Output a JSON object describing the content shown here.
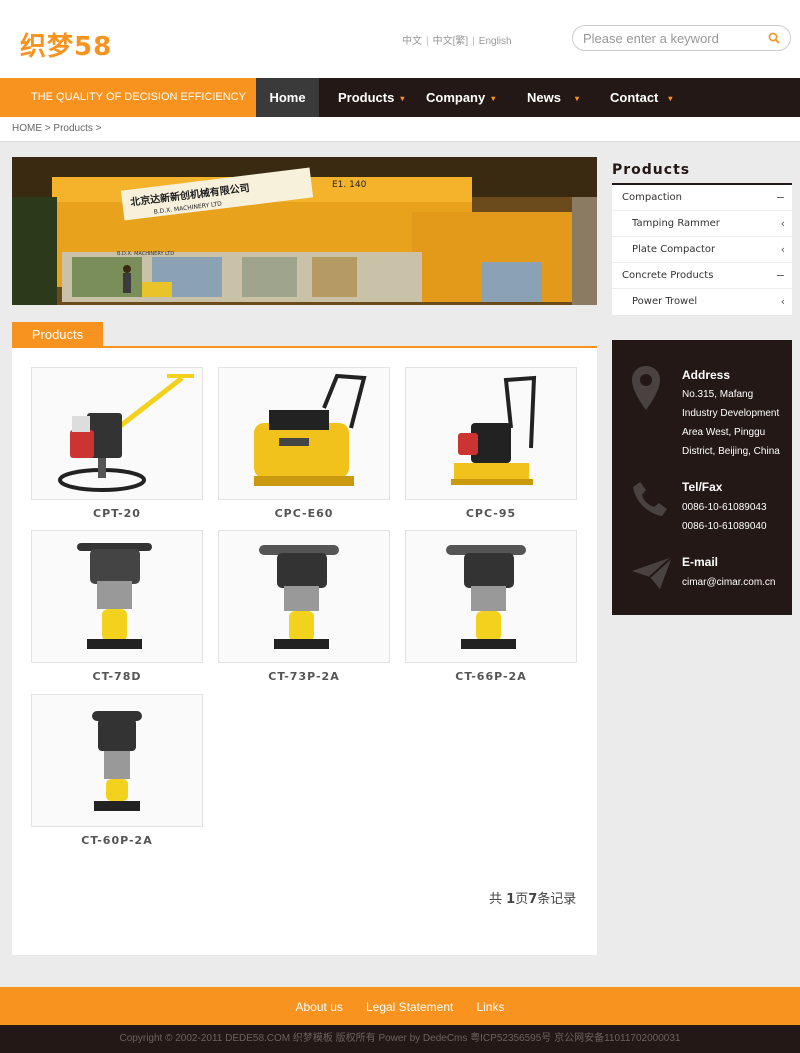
{
  "header": {
    "logo_text": "织梦58",
    "languages": [
      "中文",
      "中文[繁]",
      "English"
    ],
    "search_placeholder": "Please enter a keyword"
  },
  "nav": {
    "slogan": "THE QUALITY OF DECISION EFFICIENCY",
    "items": [
      {
        "label": "Home",
        "active": true
      },
      {
        "label": "Products"
      },
      {
        "label": "Company"
      },
      {
        "label": "News"
      },
      {
        "label": "Contact"
      }
    ]
  },
  "breadcrumb": "HOME > Products >",
  "banner": {
    "sign_cn": "北京达新新创机械有限公司",
    "sign_en": "B.D.X. MACHINERY LTD",
    "booth": "E1. 140",
    "wall_text": "B.D.X. MACHINERY LTD"
  },
  "main": {
    "tab_label": "Products",
    "products": [
      {
        "name": "CPT-20",
        "icon": "power-trowel"
      },
      {
        "name": "CPC-E60",
        "icon": "plate-compactor"
      },
      {
        "name": "CPC-95",
        "icon": "plate-compactor"
      },
      {
        "name": "CT-78D",
        "icon": "tamping-rammer"
      },
      {
        "name": "CT-73P-2A",
        "icon": "tamping-rammer"
      },
      {
        "name": "CT-66P-2A",
        "icon": "tamping-rammer"
      },
      {
        "name": "CT-60P-2A",
        "icon": "tamping-rammer"
      }
    ],
    "pager": {
      "prefix": "共",
      "pages": "1",
      "mid": "页",
      "count": "7",
      "suffix": "条记录"
    }
  },
  "sidebar": {
    "title": "Products",
    "items": [
      {
        "label": "Compaction",
        "type": "cat",
        "mark": "−"
      },
      {
        "label": "Tamping Rammer",
        "type": "sub",
        "mark": "‹"
      },
      {
        "label": "Plate Compactor",
        "type": "sub",
        "mark": "‹"
      },
      {
        "label": "Concrete Products",
        "type": "cat",
        "mark": "−"
      },
      {
        "label": "Power Trowel",
        "type": "sub",
        "mark": "‹"
      }
    ]
  },
  "contact": {
    "address_title": "Address",
    "address": "No.315, Mafang Industry Development Area West, Pinggu District, Beijing, China",
    "tel_title": "Tel/Fax",
    "tel1": "0086-10-61089043",
    "tel2": "0086-10-61089040",
    "email_title": "E-mail",
    "email": "cimar@cimar.com.cn"
  },
  "footer": {
    "links": [
      "About us",
      "Legal Statement",
      "Links"
    ],
    "copyright": "Copyright © 2002-2011 DEDE58.COM 织梦模板 版权所有 Power by DedeCms    粤ICP52356595号    京公网安备11011702000031"
  },
  "colors": {
    "accent": "#f7931e",
    "dark": "#231815",
    "background": "#ebebeb"
  }
}
